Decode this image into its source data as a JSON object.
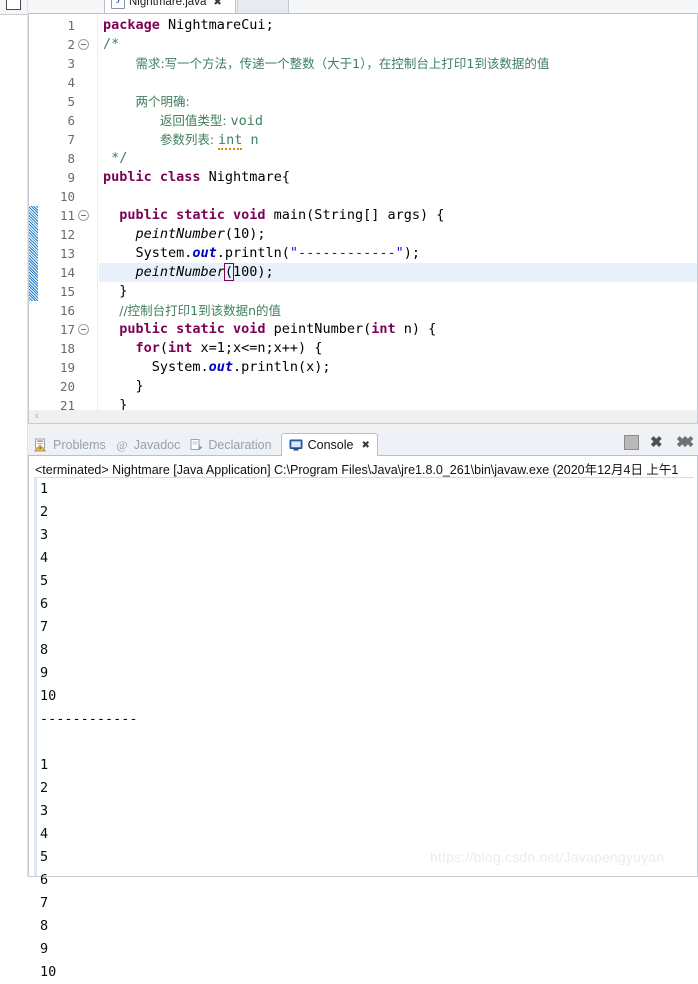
{
  "window": {
    "ide": "Eclipse IDE",
    "watermark": "https://blog.csdn.net/Javapengyuyan"
  },
  "editor": {
    "tab": {
      "label": "Nightmare.java",
      "close_glyph": "✖",
      "file_icon": "J"
    },
    "scroll_left_glyph": "‹",
    "lines": [
      {
        "num": "1",
        "fold": false,
        "changed": false,
        "current": false,
        "tokens": [
          {
            "t": "package ",
            "c": "k"
          },
          {
            "t": "NightmareCui;",
            "c": ""
          }
        ]
      },
      {
        "num": "2",
        "fold": true,
        "changed": false,
        "current": false,
        "tokens": [
          {
            "t": "/*",
            "c": "cmt"
          }
        ],
        "indent": 0
      },
      {
        "num": "3",
        "fold": false,
        "changed": false,
        "current": false,
        "tokens": [
          {
            "t": "需求:写一个方法，传递一个整数（大于1），在控制台上打印1到该数据的值",
            "c": "cmt-cn"
          }
        ],
        "indent": 4
      },
      {
        "num": "4",
        "fold": false,
        "changed": false,
        "current": false,
        "tokens": []
      },
      {
        "num": "5",
        "fold": false,
        "changed": false,
        "current": false,
        "tokens": [
          {
            "t": "两个明确:",
            "c": "cmt-cn"
          }
        ],
        "indent": 4
      },
      {
        "num": "6",
        "fold": false,
        "changed": false,
        "current": false,
        "tokens": [
          {
            "t": "返回值类型: ",
            "c": "cmt-cn"
          },
          {
            "t": "void",
            "c": "cmt"
          }
        ],
        "indent": 7
      },
      {
        "num": "7",
        "fold": false,
        "changed": false,
        "current": false,
        "tokens": [
          {
            "t": "参数列表: ",
            "c": "cmt-cn"
          },
          {
            "t": "int",
            "c": "cmt warn"
          },
          {
            "t": " n",
            "c": "cmt"
          }
        ],
        "indent": 7
      },
      {
        "num": "8",
        "fold": false,
        "changed": false,
        "current": false,
        "tokens": [
          {
            "t": " */",
            "c": "cmt"
          }
        ],
        "indent": 0
      },
      {
        "num": "9",
        "fold": false,
        "changed": false,
        "current": false,
        "tokens": [
          {
            "t": "public class ",
            "c": "k"
          },
          {
            "t": "Nightmare{",
            "c": ""
          }
        ]
      },
      {
        "num": "10",
        "fold": false,
        "changed": false,
        "current": false,
        "tokens": []
      },
      {
        "num": "11",
        "fold": true,
        "changed": true,
        "current": false,
        "tokens": [
          {
            "t": "public static void ",
            "c": "k"
          },
          {
            "t": "main(String[] args) {",
            "c": ""
          }
        ],
        "indent": 2
      },
      {
        "num": "12",
        "fold": false,
        "changed": true,
        "current": false,
        "tokens": [
          {
            "t": "peintNumber",
            "c": "mth"
          },
          {
            "t": "(10);",
            "c": ""
          }
        ],
        "indent": 4
      },
      {
        "num": "13",
        "fold": false,
        "changed": true,
        "current": false,
        "tokens": [
          {
            "t": "System.",
            "c": ""
          },
          {
            "t": "out",
            "c": "fld"
          },
          {
            "t": ".println(",
            "c": ""
          },
          {
            "t": "\"------------\"",
            "c": "str"
          },
          {
            "t": ");",
            "c": ""
          }
        ],
        "indent": 4
      },
      {
        "num": "14",
        "fold": false,
        "changed": true,
        "current": true,
        "tokens": [
          {
            "t": "peintNumber",
            "c": "mth"
          },
          {
            "t": "(",
            "c": "brk"
          },
          {
            "t": "100);",
            "c": ""
          }
        ],
        "indent": 4
      },
      {
        "num": "15",
        "fold": false,
        "changed": true,
        "current": false,
        "tokens": [
          {
            "t": "}",
            "c": ""
          }
        ],
        "indent": 2
      },
      {
        "num": "16",
        "fold": false,
        "changed": false,
        "current": false,
        "tokens": [
          {
            "t": "//控制台打印1到该数据n的值",
            "c": "cmt-cn"
          }
        ],
        "indent": 2
      },
      {
        "num": "17",
        "fold": true,
        "changed": false,
        "current": false,
        "tokens": [
          {
            "t": "public static void ",
            "c": "k"
          },
          {
            "t": "peintNumber(",
            "c": ""
          },
          {
            "t": "int",
            "c": "k"
          },
          {
            "t": " n) {",
            "c": ""
          }
        ],
        "indent": 2
      },
      {
        "num": "18",
        "fold": false,
        "changed": false,
        "current": false,
        "tokens": [
          {
            "t": "for",
            "c": "k"
          },
          {
            "t": "(",
            "c": ""
          },
          {
            "t": "int",
            "c": "k"
          },
          {
            "t": " x=1;x<=n;x++) {",
            "c": ""
          }
        ],
        "indent": 4
      },
      {
        "num": "19",
        "fold": false,
        "changed": false,
        "current": false,
        "tokens": [
          {
            "t": "System.",
            "c": ""
          },
          {
            "t": "out",
            "c": "fld"
          },
          {
            "t": ".println(x);",
            "c": ""
          }
        ],
        "indent": 6
      },
      {
        "num": "20",
        "fold": false,
        "changed": false,
        "current": false,
        "tokens": [
          {
            "t": "}",
            "c": ""
          }
        ],
        "indent": 4
      },
      {
        "num": "21",
        "fold": false,
        "changed": false,
        "current": false,
        "tokens": [
          {
            "t": "}",
            "c": ""
          }
        ],
        "indent": 2
      }
    ]
  },
  "console": {
    "tabs": [
      {
        "label": "Problems",
        "icon": "problems-icon",
        "active": false
      },
      {
        "label": "Javadoc",
        "icon": "javadoc-icon",
        "active": false
      },
      {
        "label": "Declaration",
        "icon": "declaration-icon",
        "active": false
      },
      {
        "label": "Console",
        "icon": "console-icon",
        "active": true
      }
    ],
    "tab_close_glyph": "✖",
    "toolbar": [
      {
        "name": "terminate-button",
        "glyph": ""
      },
      {
        "name": "remove-launch-button",
        "glyph": "✖"
      },
      {
        "name": "remove-all-terminated-button",
        "glyph": "✖✖"
      }
    ],
    "terminated_line": "<terminated> Nightmare [Java Application] C:\\Program Files\\Java\\jre1.8.0_261\\bin\\javaw.exe (2020年12月4日 上午1",
    "output": [
      "1",
      "2",
      "3",
      "4",
      "5",
      "6",
      "7",
      "8",
      "9",
      "10",
      "------------",
      "",
      "1",
      "2",
      "3",
      "4",
      "5",
      "6",
      "7",
      "8",
      "9",
      "10"
    ]
  }
}
